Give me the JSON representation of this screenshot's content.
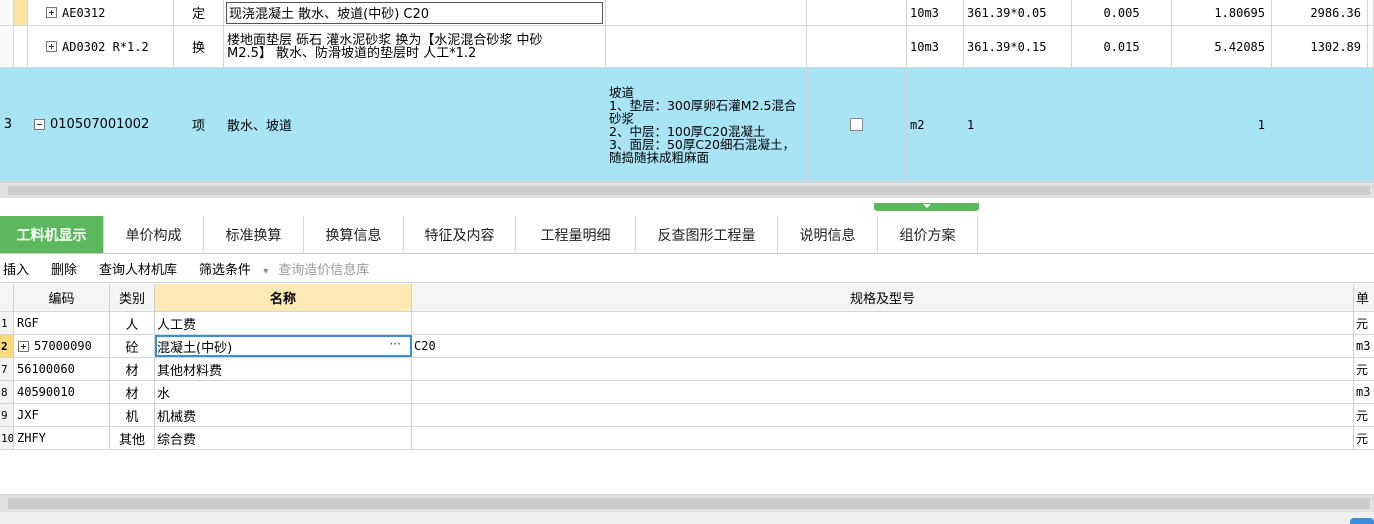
{
  "upper_grid": {
    "rows": [
      {
        "code": "AE0312",
        "category": "定",
        "name": "现浇混凝土 散水、坡道(中砂) C20",
        "unit": "10m3",
        "expr": "361.39*0.05",
        "content": "0.005",
        "quantity": "1.80695",
        "price": "2986.36"
      },
      {
        "code": "AD0302 R*1.2",
        "category": "换",
        "name": "楼地面垫层 砾石 灌水泥砂浆  换为【水泥混合砂浆 中砂 M2.5】 散水、防滑坡道的垫层时 人工*1.2",
        "unit": "10m3",
        "expr": "361.39*0.15",
        "content": "0.015",
        "quantity": "5.42085",
        "price": "1302.89"
      },
      {
        "index": "3",
        "code": "010507001002",
        "category": "项",
        "name": "散水、坡道",
        "feature": "坡道\n1、垫层：300厚卵石灌M2.5混合砂浆\n2、中层：100厚C20混凝土\n3、面层：50厚C20细石混凝土，随捣随抹成粗麻面",
        "unit": "m2",
        "expr": "1",
        "quantity": "1"
      }
    ]
  },
  "tabs": [
    {
      "label": "工料机显示",
      "active": true
    },
    {
      "label": "单价构成"
    },
    {
      "label": "标准换算"
    },
    {
      "label": "换算信息"
    },
    {
      "label": "特征及内容"
    },
    {
      "label": "工程量明细"
    },
    {
      "label": "反查图形工程量"
    },
    {
      "label": "说明信息"
    },
    {
      "label": "组价方案"
    }
  ],
  "toolbar": {
    "insert": "插入",
    "delete": "删除",
    "query_lib": "查询人材机库",
    "filter": "筛选条件",
    "filter_arrow": "▾",
    "query_price": "查询造价信息库"
  },
  "lower_grid": {
    "headers": {
      "code": "编码",
      "category": "类别",
      "name": "名称",
      "spec": "规格及型号",
      "unit": "单"
    },
    "rows": [
      {
        "idx": "1",
        "code": "RGF",
        "category": "人",
        "name": "人工费",
        "spec": "",
        "unit": "元"
      },
      {
        "idx": "2",
        "code": "57000090",
        "category": "砼",
        "name": "混凝土(中砂)",
        "spec": "C20",
        "unit": "m3"
      },
      {
        "idx": "7",
        "code": "56100060",
        "category": "材",
        "name": "其他材料费",
        "spec": "",
        "unit": "元"
      },
      {
        "idx": "8",
        "code": "40590010",
        "category": "材",
        "name": "水",
        "spec": "",
        "unit": "m3"
      },
      {
        "idx": "9",
        "code": "JXF",
        "category": "机",
        "name": "机械费",
        "spec": "",
        "unit": "元"
      },
      {
        "idx": "10",
        "code": "ZHFY",
        "category": "其他",
        "name": "综合费",
        "spec": "",
        "unit": "元"
      }
    ],
    "ellipsis": "···"
  },
  "colors": {
    "selected_row": "#a8e4f6",
    "active_tab": "#5cb85c",
    "header_highlight": "#fde9b4",
    "current_row_marker": "#fcd97a"
  }
}
